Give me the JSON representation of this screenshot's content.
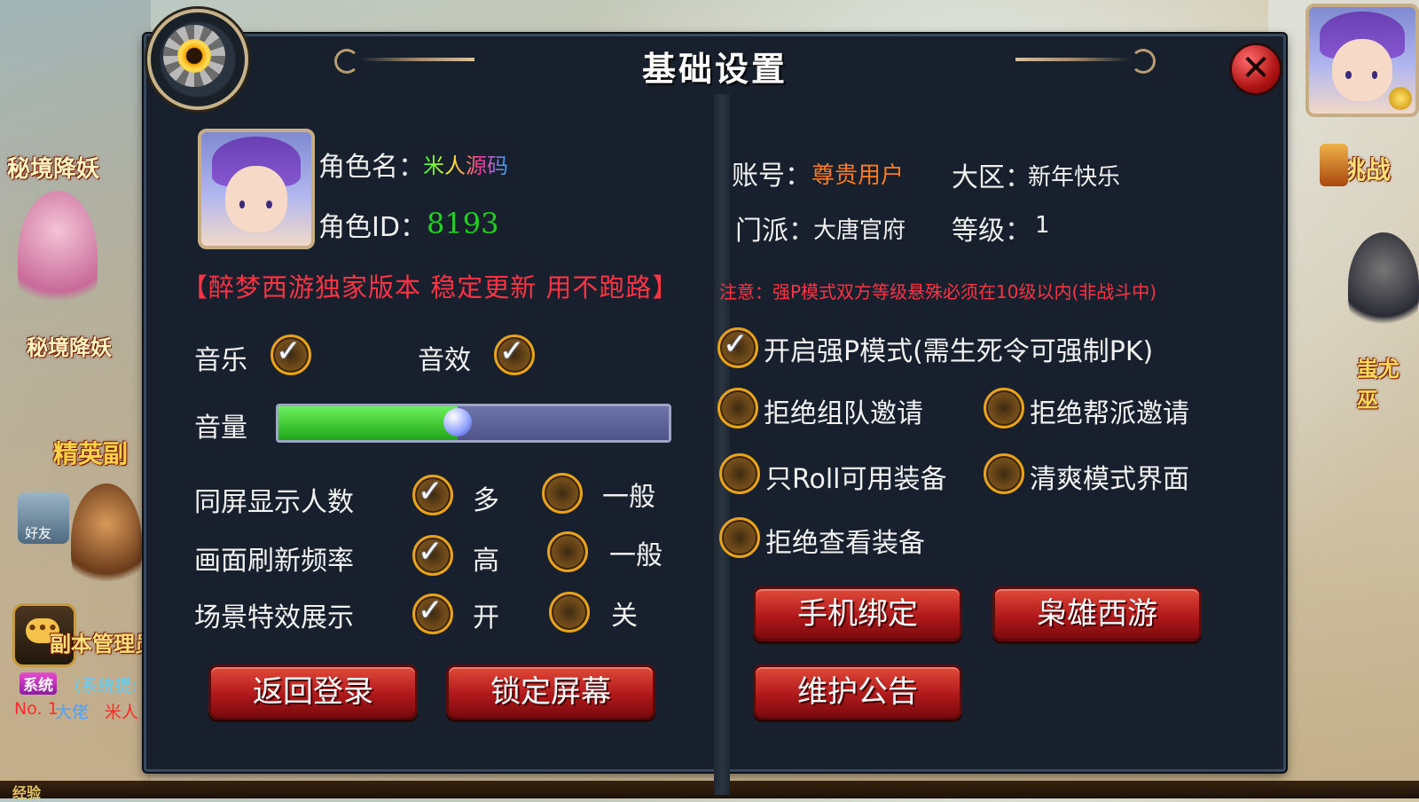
{
  "panel": {
    "title": "基础设置",
    "close_glyph": "✕"
  },
  "left_side": {
    "label_top": "秘境降妖",
    "label_mid": "秘境降妖",
    "label_elite": "精英副",
    "friend": "好友",
    "admin": "副本管理员",
    "chat_icon": "chat-bubble-icon",
    "sys_tag": "系统",
    "sys_msg": "(系统提:",
    "rank_line_1": "No. 1",
    "rank_line_2": "大佬",
    "rank_line_3": "米人",
    "xp": "经验"
  },
  "right_side": {
    "challenge": "挑战",
    "npc_name": "蚩尤巫"
  },
  "character": {
    "name_label": "角色名：",
    "name_value": "米人源码",
    "id_label": "角色ID：",
    "id_value": "8193"
  },
  "notice_left": "【醉梦西游独家版本  稳定更新  用不跑路】",
  "audio": {
    "music_label": "音乐",
    "music_checked": true,
    "sfx_label": "音效",
    "sfx_checked": true,
    "volume_label": "音量",
    "volume_level": 0.46
  },
  "display": {
    "crowd_label": "同屏显示人数",
    "crowd_opt1": "多",
    "crowd_opt2": "一般",
    "crowd_selected": "多",
    "refresh_label": "画面刷新频率",
    "refresh_opt1": "高",
    "refresh_opt2": "一般",
    "refresh_selected": "高",
    "fx_label": "场景特效展示",
    "fx_opt1": "开",
    "fx_opt2": "关",
    "fx_selected": "开"
  },
  "buttons_left": {
    "back_login": "返回登录",
    "lock_screen": "锁定屏幕"
  },
  "account": {
    "account_label": "账号：",
    "account_value": "尊贵用户",
    "region_label": "大区：",
    "region_value": "新年快乐",
    "sect_label": "门派：",
    "sect_value": "大唐官府",
    "level_label": "等级：",
    "level_value": "1"
  },
  "notice_right": "注意：强P模式双方等级悬殊必须在10级以内(非战斗中)",
  "toggles": {
    "force_pk": "开启强P模式(需生死令可强制PK)",
    "force_pk_checked": true,
    "reject_team": "拒绝组队邀请",
    "reject_team_checked": false,
    "reject_guild": "拒绝帮派邀请",
    "reject_guild_checked": false,
    "roll_usable": "只Roll可用装备",
    "roll_usable_checked": false,
    "clean_ui": "清爽模式界面",
    "clean_ui_checked": false,
    "reject_view": "拒绝查看装备",
    "reject_view_checked": false
  },
  "buttons_right": {
    "phone_bind": "手机绑定",
    "xiaoxiong": "枭雄西游",
    "maintenance": "维护公告"
  },
  "colors": {
    "panel_bg": "#17202c",
    "accent_red": "#ff3344",
    "id_green": "#1fd11f",
    "account_orange": "#ff7a1a",
    "checkbox_ring": "#e8a318"
  }
}
